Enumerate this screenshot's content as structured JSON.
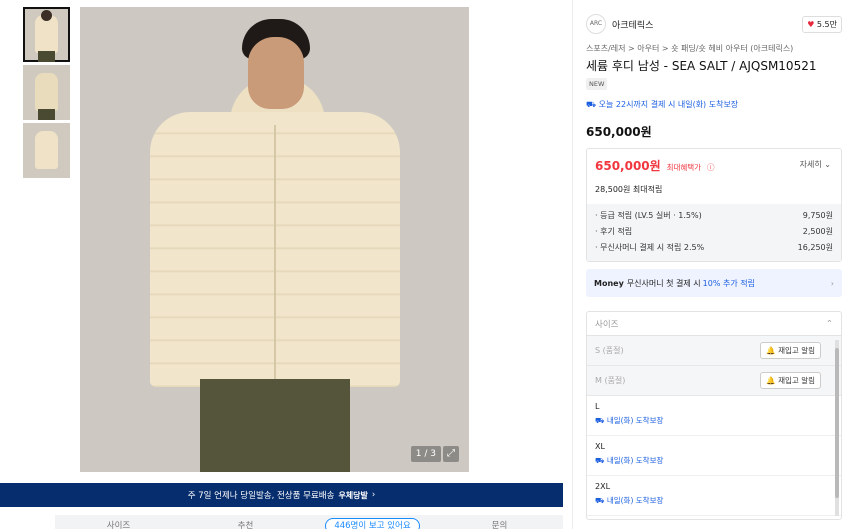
{
  "gallery": {
    "counter": "1 / 3",
    "expand_icon": "expand-icon",
    "thumbnail_count": 3
  },
  "banner": {
    "text": "주 7일 언제나 당일발송, 전상품 무료배송",
    "logo": "우체당발",
    "arrow": "›"
  },
  "tabs": [
    {
      "label": "사이즈"
    },
    {
      "label": "추천"
    },
    {
      "label": "446명이 보고 있어요"
    },
    {
      "label": "문의"
    }
  ],
  "store": {
    "name": "아크테릭스",
    "likes": "5.5만"
  },
  "breadcrumb": "스포츠/레저 > 아우터 > 숏 패딩/숏 헤비 아우터 (아크테릭스)",
  "product": {
    "title": "세륨 후디 남성 - SEA SALT / AJQSM10521",
    "badge": "NEW",
    "delivery": "오늘 22시까지 결제 시 내일(화) 도착보장",
    "price": "650,000원"
  },
  "benefit": {
    "price": "650,000원",
    "tag": "최대혜택가",
    "detail": "자세히",
    "points": "28,500원 최대적립",
    "rows": [
      {
        "label": "· 등급 적립 (LV.5 실버 · 1.5%)",
        "value": "9,750원"
      },
      {
        "label": "· 후기 적립",
        "value": "2,500원"
      },
      {
        "label": "· 무신사머니 결제 시 적립 2.5%",
        "value": "16,250원"
      }
    ]
  },
  "money": {
    "brand": "Money",
    "text": "무신사머니 첫 결제 시",
    "highlight": "10% 추가 적립"
  },
  "size": {
    "header": "사이즈",
    "soldout": [
      {
        "label": "S (품절)",
        "button": "재입고 알림"
      },
      {
        "label": "M (품절)",
        "button": "재입고 알림"
      }
    ],
    "available": [
      {
        "label": "L",
        "delivery": "내일(화) 도착보장"
      },
      {
        "label": "XL",
        "delivery": "내일(화) 도착보장"
      },
      {
        "label": "2XL",
        "delivery": "내일(화) 도착보장"
      }
    ]
  }
}
